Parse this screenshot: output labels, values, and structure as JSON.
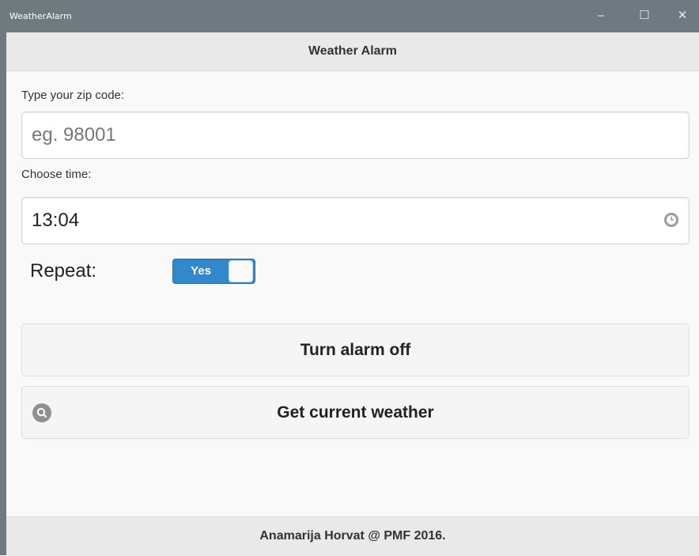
{
  "window": {
    "title": "WeatherAlarm",
    "minimize": "–",
    "maximize": "☐",
    "close": "✕"
  },
  "header": {
    "title": "Weather Alarm"
  },
  "zip": {
    "label": "Type your zip code:",
    "placeholder": "eg. 98001",
    "value": ""
  },
  "time": {
    "label": "Choose time:",
    "value": "13:04",
    "icon": "clock-icon"
  },
  "repeat": {
    "label": "Repeat:",
    "toggle_label": "Yes",
    "state": "on"
  },
  "buttons": {
    "alarm_off": "Turn alarm off",
    "get_weather": "Get current weather",
    "get_weather_icon": "search-icon"
  },
  "footer": {
    "text": "Anamarija Horvat @ PMF 2016."
  },
  "colors": {
    "titlebar": "#6f7a80",
    "toggle_accent": "#3388cc"
  }
}
